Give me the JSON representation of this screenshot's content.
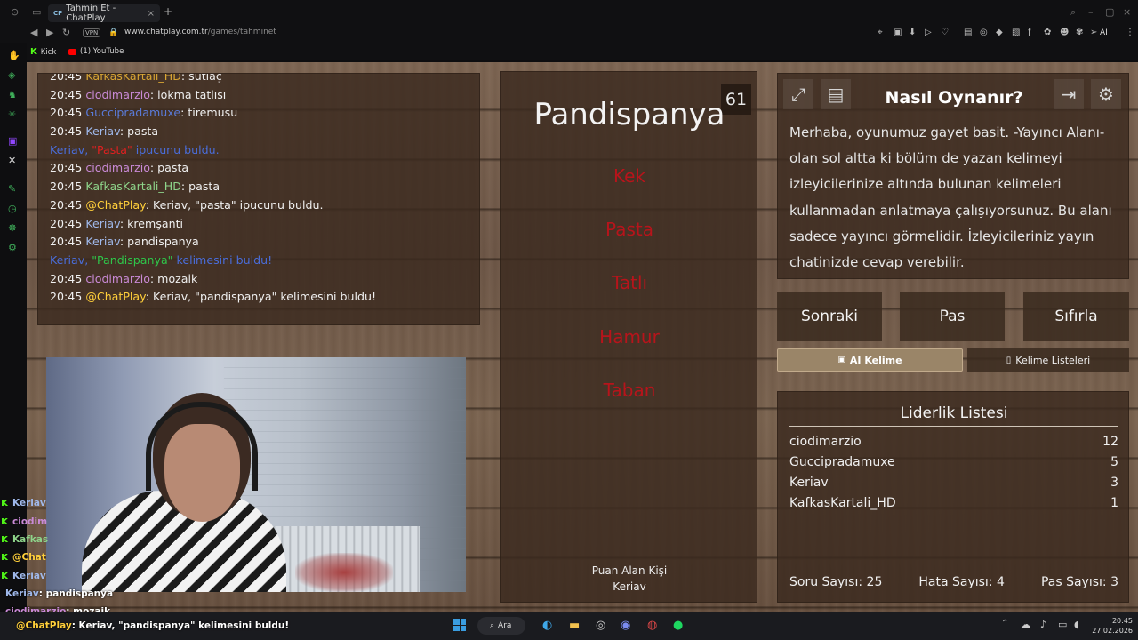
{
  "browser": {
    "tab_title": "Tahmin Et - ChatPlay",
    "tab_favicon": "CP",
    "vpn_label": "VPN",
    "url_host": "www.chatplay.com.tr",
    "url_path": "/games/tahminet",
    "ai_label": "AI",
    "bookmarks": [
      {
        "label": "Kick",
        "icon": "kick-icon"
      },
      {
        "label": "(1) YouTube",
        "icon": "youtube-icon"
      }
    ]
  },
  "chat": {
    "lines": [
      {
        "time": "20:45",
        "user": "KafkasKartali_HD",
        "msg": "sütlaç"
      },
      {
        "time": "20:45",
        "user": "ciodimarzio",
        "msg": "lokma tatlısı"
      },
      {
        "time": "20:45",
        "user": "Guccipradamuxe",
        "msg": "tiremusu"
      },
      {
        "time": "20:45",
        "user": "Keriav",
        "msg": "pasta"
      },
      {
        "sys_user": "Keriav, ",
        "sys_word": "\"Pasta\"",
        "sys_rest": " ipucunu buldu."
      },
      {
        "time": "20:45",
        "user": "ciodimarzio",
        "msg": "pasta"
      },
      {
        "time": "20:45",
        "user": "KafkasKartali_HD",
        "msg": "pasta"
      },
      {
        "time": "20:45",
        "user": "@ChatPlay",
        "msg": "Keriav, \"pasta\" ipucunu buldu."
      },
      {
        "time": "20:45",
        "user": "Keriav",
        "msg": "kremşanti"
      },
      {
        "time": "20:45",
        "user": "Keriav",
        "msg": "pandispanya"
      },
      {
        "sys_user": "Keriav, ",
        "sys_word": "\"Pandispanya\"",
        "sys_rest": " kelimesini buldu!"
      },
      {
        "time": "20:45",
        "user": "ciodimarzio",
        "msg": "mozaik"
      },
      {
        "time": "20:45",
        "user": "@ChatPlay",
        "msg": "Keriav, \"pandispanya\" kelimesini buldu!"
      }
    ]
  },
  "game": {
    "timer": "61",
    "word": "Pandispanya",
    "forbidden": [
      "Kek",
      "Pasta",
      "Tatlı",
      "Hamur",
      "Taban"
    ],
    "scorer_label": "Puan Alan Kişi",
    "scorer": "Keriav"
  },
  "howto": {
    "title": "Nasıl Oynanır?",
    "text": "Merhaba, oyunumuz gayet basit. -Yayıncı Alanı- olan sol altta ki bölüm de yazan kelimeyi izleyicilerinize altında bulunan kelimeleri kullanmadan anlatmaya çalışıyorsunuz. Bu alanı sadece yayıncı görmelidir. İzleyicileriniz yayın chatinizde cevap verebilir."
  },
  "actions": {
    "next": "Sonraki",
    "pass": "Pas",
    "reset": "Sıfırla",
    "ai_word": "AI Kelime",
    "word_lists": "Kelime Listeleri"
  },
  "leaderboard": {
    "title": "Liderlik Listesi",
    "rows": [
      {
        "name": "ciodimarzio",
        "score": "12"
      },
      {
        "name": "Guccipradamuxe",
        "score": "5"
      },
      {
        "name": "Keriav",
        "score": "3"
      },
      {
        "name": "KafkasKartali_HD",
        "score": "1"
      }
    ],
    "questions_label": "Soru Sayısı:",
    "questions": "25",
    "errors_label": "Hata Sayısı:",
    "errors": "4",
    "passes_label": "Pas Sayısı:",
    "passes": "3"
  },
  "overlay": {
    "kick_users": [
      "Keriav",
      "ciodim",
      "Kafkas",
      "@Chat",
      "Keriav"
    ],
    "lines": [
      {
        "user": "Keriav",
        "msg": " : pandispanya"
      },
      {
        "user": "ciodimarzio",
        "msg": " : mozaik"
      },
      {
        "user": "@ChatPlay",
        "msg": " : Keriav, \"pandispanya\" kelimesini buldu!"
      }
    ]
  },
  "taskbar": {
    "search": "Ara",
    "time": "20:45",
    "date": "27.02.2026"
  },
  "colors": {
    "forbidden_red": "#b7141b",
    "ai_button": "#9a8568",
    "kick_green": "#53fc18"
  }
}
